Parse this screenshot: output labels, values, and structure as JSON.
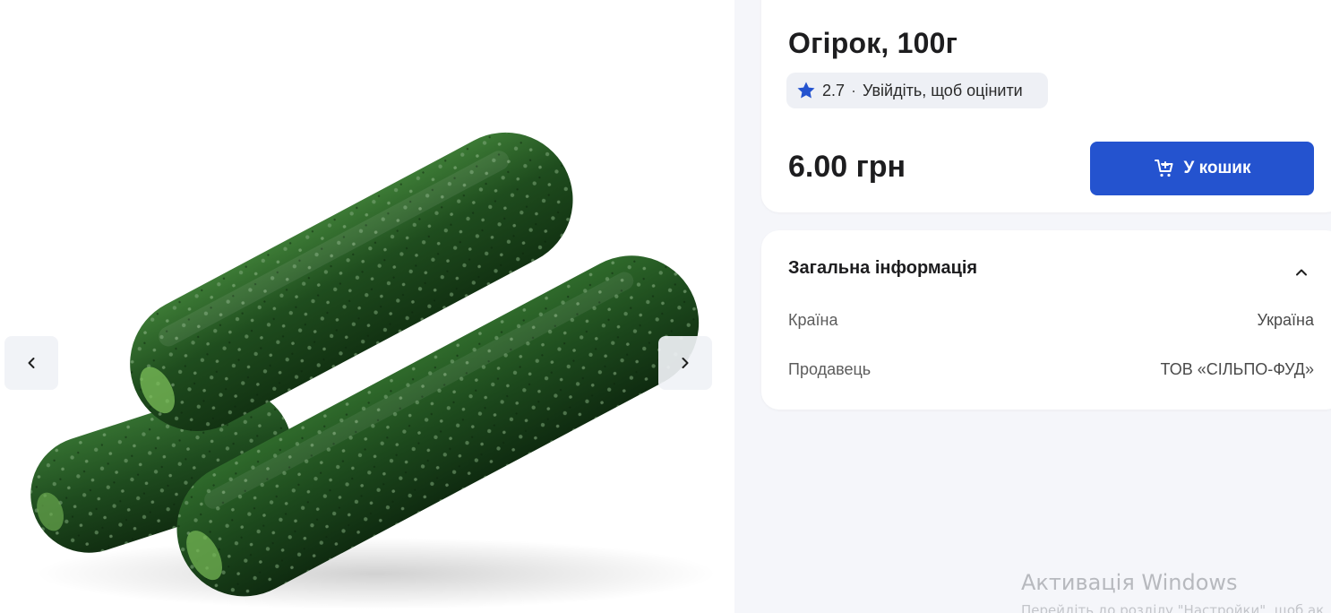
{
  "product": {
    "title": "Огірок, 100г",
    "image_alt": "cucumbers-image",
    "rating_value": "2.7",
    "rating_separator": "·",
    "rating_login_text": "Увійдіть, щоб оцінити",
    "price": "6.00 грн",
    "add_to_cart_label": "У кошик"
  },
  "info": {
    "heading": "Загальна інформація",
    "rows": [
      {
        "label": "Країна",
        "value": "Україна"
      },
      {
        "label": "Продавець",
        "value": "ТОВ «СІЛЬПО-ФУД»"
      }
    ]
  },
  "overlay": {
    "watermark_title": "Активація Windows",
    "watermark_subtitle": "Перейдіть до розділу \"Настройки\", щоб ак"
  },
  "icons": {
    "star": "star-icon",
    "cart": "cart-add-icon",
    "prev": "chevron-left-icon",
    "next": "chevron-right-icon",
    "collapse": "chevron-up-icon"
  },
  "colors": {
    "accent": "#2453cf",
    "panel_bg": "#f5f6fa",
    "card_bg": "#ffffff",
    "chip_bg": "#eef0f5"
  }
}
